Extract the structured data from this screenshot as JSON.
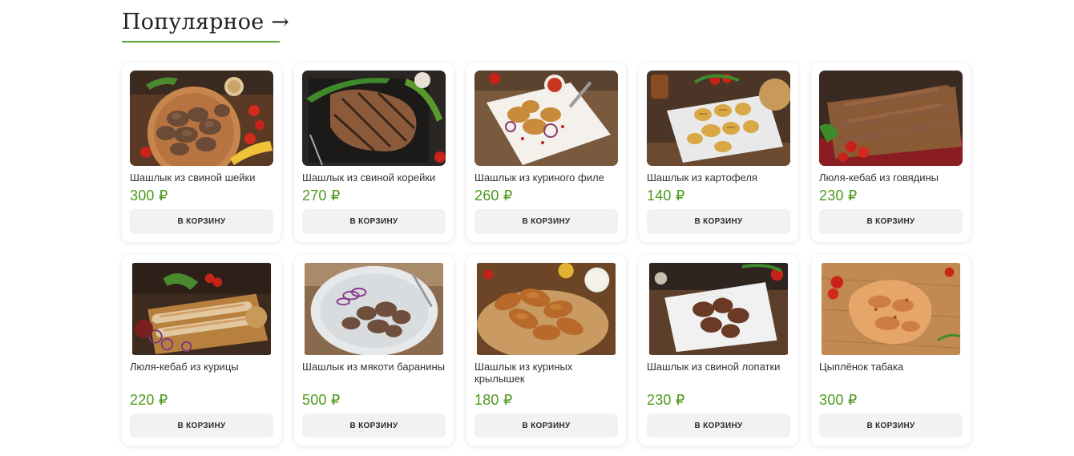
{
  "section": {
    "title": "Популярное →",
    "accent": "#5aa02c",
    "price_color": "#4e9a1d"
  },
  "products": [
    {
      "name": "Шашлык из свиной шейки",
      "price": "300 ₽",
      "button": "В КОРЗИНУ",
      "image": "pork-neck-skewer-photo"
    },
    {
      "name": "Шашлык из свиной корейки",
      "price": "270 ₽",
      "button": "В КОРЗИНУ",
      "image": "pork-loin-steak-photo"
    },
    {
      "name": "Шашлык из куриного филе",
      "price": "260 ₽",
      "button": "В КОРЗИНУ",
      "image": "chicken-fillet-plate-photo"
    },
    {
      "name": "Шашлык из картофеля",
      "price": "140 ₽",
      "button": "В КОРЗИНУ",
      "image": "grilled-potato-plate-photo"
    },
    {
      "name": "Люля-кебаб из говядины",
      "price": "230 ₽",
      "button": "В КОРЗИНУ",
      "image": "beef-kebab-board-photo"
    },
    {
      "name": "Люля-кебаб из курицы",
      "price": "220 ₽",
      "button": "В КОРЗИНУ",
      "image": "chicken-kebab-board-photo"
    },
    {
      "name": "Шашлык из мякоти баранины",
      "price": "500 ₽",
      "button": "В КОРЗИНУ",
      "image": "lamb-plate-photo"
    },
    {
      "name": "Шашлык из куриных крылышек",
      "price": "180 ₽",
      "button": "В КОРЗИНУ",
      "image": "chicken-wings-photo"
    },
    {
      "name": "Шашлык из свиной лопатки",
      "price": "230 ₽",
      "button": "В КОРЗИНУ",
      "image": "pork-shoulder-plate-photo"
    },
    {
      "name": "Цыплёнок табака",
      "price": "300 ₽",
      "button": "В КОРЗИНУ",
      "image": "tabaka-chicken-photo"
    }
  ]
}
